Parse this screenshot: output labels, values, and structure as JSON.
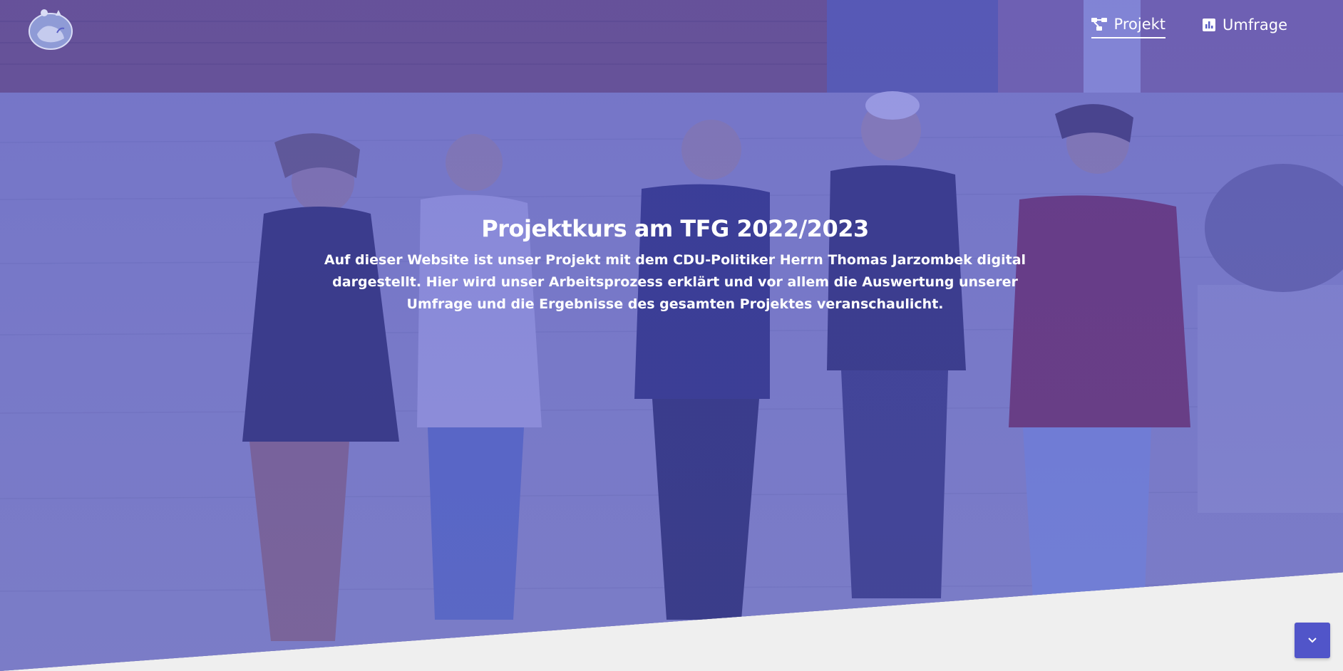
{
  "nav": {
    "items": [
      {
        "label": "Projekt",
        "icon": "diagram-project-icon",
        "active": true
      },
      {
        "label": "Umfrage",
        "icon": "bar-chart-icon",
        "active": false
      }
    ]
  },
  "hero": {
    "title": "Projektkurs am TFG 2022/2023",
    "description": "Auf dieser Website ist unser Projekt mit dem CDU-Politiker Herrn Thomas Jarzombek digital dargestellt. Hier wird unser Arbeitsprozess erklärt und vor allem die Auswertung unserer Umfrage und die Ergebnisse des gesamten Projektes veranschaulicht."
  },
  "scroll_button": {
    "icon": "chevron-down-icon"
  },
  "colors": {
    "overlay": "#5a5cd6",
    "accent": "#5155c9",
    "background": "#efefef",
    "text": "#ffffff"
  }
}
